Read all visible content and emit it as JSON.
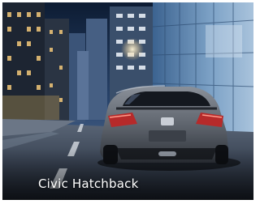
{
  "caption": {
    "title": "Civic Hatchback"
  }
}
